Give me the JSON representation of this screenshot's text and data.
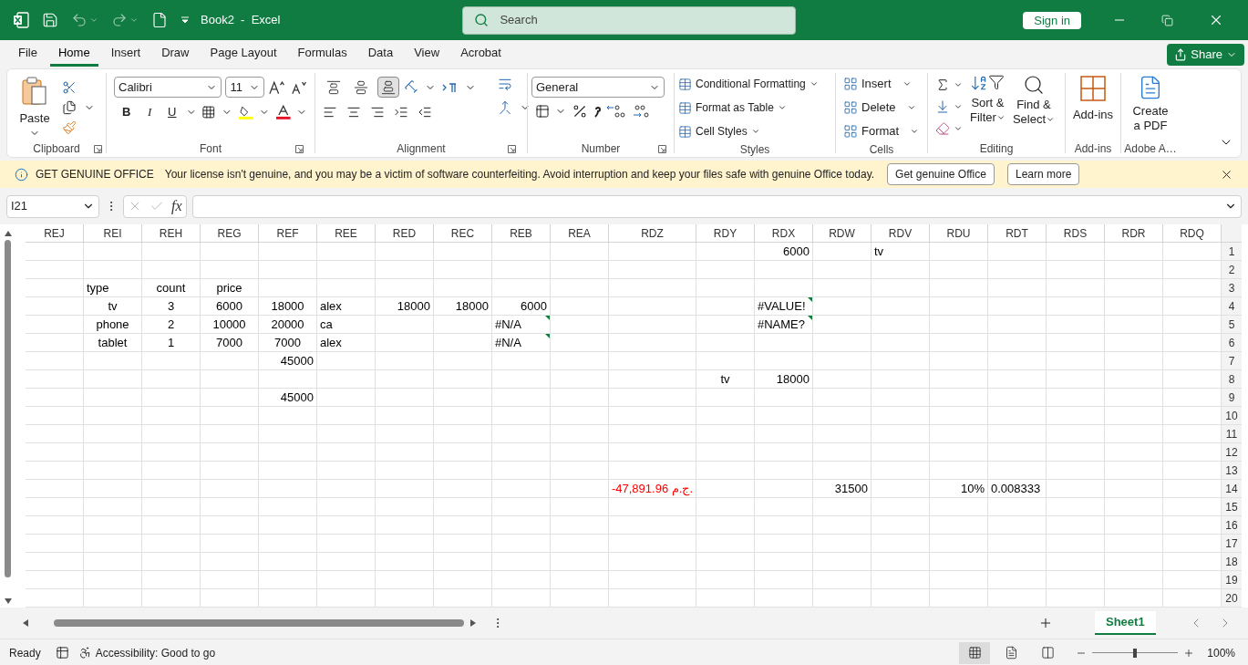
{
  "title_bar": {
    "title": "Book2  -  Excel",
    "search_placeholder": "Search",
    "sign_in": "Sign in"
  },
  "menu_tabs": [
    {
      "label": "File",
      "selected": false
    },
    {
      "label": "Home",
      "selected": true
    },
    {
      "label": "Insert",
      "selected": false
    },
    {
      "label": "Draw",
      "selected": false
    },
    {
      "label": "Page Layout",
      "selected": false
    },
    {
      "label": "Formulas",
      "selected": false
    },
    {
      "label": "Data",
      "selected": false
    },
    {
      "label": "View",
      "selected": false
    },
    {
      "label": "Acrobat",
      "selected": false
    }
  ],
  "share": "Share",
  "ribbon": {
    "clipboard": {
      "paste": "Paste",
      "label": "Clipboard"
    },
    "font": {
      "name": "Calibri",
      "size": "11",
      "bold": "B",
      "italic": "I",
      "underline": "U",
      "label": "Font"
    },
    "alignment": {
      "vertical": [
        {
          "kind": "top",
          "selected": false
        },
        {
          "kind": "middle",
          "selected": false
        },
        {
          "kind": "bottom",
          "selected": true
        }
      ],
      "label": "Alignment"
    },
    "number": {
      "format": "General",
      "label": "Number"
    },
    "styles": {
      "items": [
        "Conditional Formatting",
        "Format as Table",
        "Cell Styles"
      ],
      "label": "Styles"
    },
    "cells": {
      "items": [
        "Insert",
        "Delete",
        "Format"
      ],
      "label": "Cells"
    },
    "editing": {
      "sort": [
        "Sort &",
        "Filter"
      ],
      "find": [
        "Find &",
        "Select"
      ],
      "label": "Editing"
    },
    "addins": {
      "button": "Add-ins",
      "label": "Add-ins"
    },
    "adobe": {
      "button": [
        "Create",
        "a PDF"
      ],
      "label": "Adobe A…"
    }
  },
  "notice": {
    "title": "GET GENUINE OFFICE",
    "message": "Your license isn't genuine, and you may be a victim of software counterfeiting. Avoid interruption and keep your files safe with genuine Office today.",
    "buttons": [
      "Get genuine Office",
      "Learn more"
    ]
  },
  "formula_bar": {
    "name_box": "I21",
    "fx": "fx"
  },
  "grid": {
    "columns": [
      "REJ",
      "REI",
      "REH",
      "REG",
      "REF",
      "REE",
      "RED",
      "REC",
      "REB",
      "REA",
      "RDZ",
      "RDY",
      "RDX",
      "RDW",
      "RDV",
      "RDU",
      "RDT",
      "RDS",
      "RDR",
      "RDQ"
    ],
    "rows": [
      {
        "number": "1",
        "cells": [
          null,
          null,
          null,
          null,
          null,
          null,
          null,
          null,
          null,
          null,
          null,
          null,
          {
            "text": "6000",
            "kind": "number"
          },
          null,
          {
            "text": "tv",
            "kind": "text"
          }
        ]
      },
      {
        "number": "2",
        "cells": []
      },
      {
        "number": "3",
        "cells": [
          null,
          {
            "text": "type",
            "kind": "text"
          },
          {
            "text": "count",
            "kind": "centered"
          },
          {
            "text": "price",
            "kind": "centered"
          }
        ]
      },
      {
        "number": "4",
        "cells": [
          null,
          {
            "text": "tv",
            "kind": "centered"
          },
          {
            "text": "3",
            "kind": "centered"
          },
          {
            "text": "6000",
            "kind": "centered"
          },
          {
            "text": "18000",
            "kind": "centered"
          },
          {
            "text": "alex",
            "kind": "text"
          },
          {
            "text": "18000",
            "kind": "number"
          },
          {
            "text": "18000",
            "kind": "number"
          },
          {
            "text": "6000",
            "kind": "number"
          },
          null,
          null,
          null,
          {
            "text": "#VALUE!",
            "kind": "text",
            "error_flag": true
          }
        ]
      },
      {
        "number": "5",
        "cells": [
          null,
          {
            "text": "phone",
            "kind": "centered"
          },
          {
            "text": "2",
            "kind": "centered"
          },
          {
            "text": "10000",
            "kind": "centered"
          },
          {
            "text": "20000",
            "kind": "centered"
          },
          {
            "text": "ca",
            "kind": "text"
          },
          null,
          null,
          {
            "text": "#N/A",
            "kind": "text",
            "error_flag": true
          },
          null,
          null,
          null,
          {
            "text": "#NAME?",
            "kind": "text",
            "error_flag": true
          }
        ]
      },
      {
        "number": "6",
        "cells": [
          null,
          {
            "text": "tablet",
            "kind": "centered"
          },
          {
            "text": "1",
            "kind": "centered"
          },
          {
            "text": "7000",
            "kind": "centered"
          },
          {
            "text": "7000",
            "kind": "centered"
          },
          {
            "text": "alex",
            "kind": "text"
          },
          null,
          null,
          {
            "text": "#N/A",
            "kind": "text",
            "error_flag": true
          }
        ]
      },
      {
        "number": "7",
        "cells": [
          null,
          null,
          null,
          null,
          {
            "text": "45000",
            "kind": "number"
          }
        ]
      },
      {
        "number": "8",
        "cells": [
          null,
          null,
          null,
          null,
          null,
          null,
          null,
          null,
          null,
          null,
          null,
          {
            "text": "tv",
            "kind": "centered"
          },
          {
            "text": "18000",
            "kind": "number"
          }
        ]
      },
      {
        "number": "9",
        "cells": [
          null,
          null,
          null,
          null,
          {
            "text": "45000",
            "kind": "number"
          }
        ]
      },
      {
        "number": "10",
        "cells": []
      },
      {
        "number": "11",
        "cells": []
      },
      {
        "number": "12",
        "cells": []
      },
      {
        "number": "13",
        "cells": []
      },
      {
        "number": "14",
        "cells": [
          null,
          null,
          null,
          null,
          null,
          null,
          null,
          null,
          null,
          null,
          {
            "text": "-47,891.96 ج.م.",
            "kind": "number",
            "negative": true
          },
          null,
          null,
          {
            "text": "31500",
            "kind": "number"
          },
          null,
          {
            "text": "10%",
            "kind": "number"
          },
          {
            "text": "0.008333",
            "kind": "text"
          }
        ]
      },
      {
        "number": "15",
        "cells": []
      },
      {
        "number": "16",
        "cells": []
      },
      {
        "number": "17",
        "cells": []
      },
      {
        "number": "18",
        "cells": []
      },
      {
        "number": "19",
        "cells": []
      },
      {
        "number": "20",
        "cells": []
      }
    ]
  },
  "sheet_tabs": [
    {
      "label": "Sheet1",
      "selected": true
    }
  ],
  "status_bar": {
    "mode": "Ready",
    "accessibility": "Accessibility: Good to go",
    "views": [
      {
        "kind": "normal",
        "selected": true
      },
      {
        "kind": "page_layout",
        "selected": false
      },
      {
        "kind": "page_break",
        "selected": false
      }
    ],
    "zoom_slider": {
      "level": 0.5
    },
    "zoom": "100%"
  }
}
